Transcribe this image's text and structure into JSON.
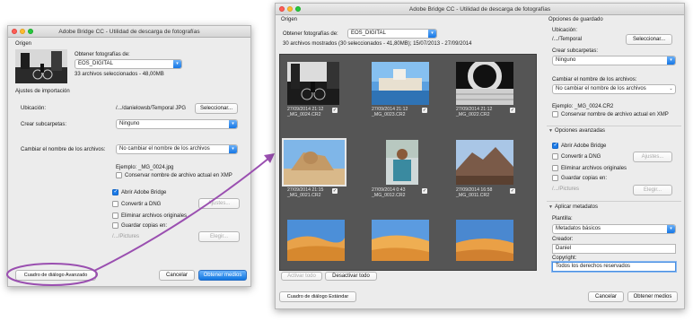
{
  "accent": "#1a7ae8",
  "annotation_color": "#9a4fb0",
  "left": {
    "title": "Adobe Bridge CC - Utilidad de descarga de fotografías",
    "origen": "Origen",
    "source_label": "Obtener fotografías de:",
    "source_value": "EOS_DIGITAL",
    "selected_info": "33 archivos seleccionados - 48,00MB",
    "import_settings": "Ajustes de importación",
    "location_label": "Ubicación:",
    "location_value": "/.../danielowsb/Temporal JPG",
    "choose_button": "Seleccionar...",
    "subfolders_label": "Crear subcarpetas:",
    "subfolders_value": "Ninguno",
    "rename_label": "Cambiar el nombre de los archivos:",
    "rename_value": "No cambiar el nombre de los archivos",
    "example": "Ejemplo: _MG_0024.jpg",
    "keep_name": "Conservar nombre de archivo actual en XMP",
    "open_bridge": "Abrir Adobe Bridge",
    "convert_dng": "Convertir a DNG",
    "settings_button": "Ajustes...",
    "delete_originals": "Eliminar archivos originales",
    "save_copies": "Guardar copias en:",
    "copies_path": "/.../Pictures",
    "choose2_button": "Elegir...",
    "advanced_button": "Cuadro de diálogo Avanzado",
    "cancel_button": "Cancelar",
    "get_media_button": "Obtener medios"
  },
  "right": {
    "title": "Adobe Bridge CC - Utilidad de descarga de fotografías",
    "origen": "Origen",
    "source_label": "Obtener fotografías de:",
    "source_value": "EOS_DIGITAL",
    "shown_info": "30 archivos mostrados (30 seleccionados - 41,80MB); 15/07/2013 - 27/09/2014",
    "thumbs": [
      {
        "date": "27/09/2014 21:12",
        "file": "_MG_0024.CR2"
      },
      {
        "date": "27/09/2014 21:12",
        "file": "_MG_0023.CR2"
      },
      {
        "date": "27/09/2014 21:12",
        "file": "_MG_0022.CR2"
      },
      {
        "date": "27/09/2014 21:15",
        "file": "_MG_0021.CR2"
      },
      {
        "date": "27/09/2014 0:43",
        "file": "_MG_0012.CR2"
      },
      {
        "date": "27/09/2014 16:58",
        "file": "_MG_0011.CR2"
      },
      {
        "date": "",
        "file": ""
      },
      {
        "date": "",
        "file": ""
      },
      {
        "date": "",
        "file": ""
      }
    ],
    "check_all": "Activar todo",
    "uncheck_all": "Desactivar todo",
    "save_options": "Opciones de guardado",
    "location_label": "Ubicación:",
    "location_value": "/.../Temporal",
    "choose_button": "Seleccionar...",
    "subfolders_label": "Crear subcarpetas:",
    "subfolders_value": "Ninguno",
    "rename_label": "Cambiar el nombre de los archivos:",
    "rename_value": "No cambiar el nombre de los archivos",
    "example": "Ejemplo: _MG_0024.CR2",
    "keep_name": "Conservar nombre de archivo actual en XMP",
    "advanced_options": "Opciones avanzadas",
    "open_bridge": "Abrir Adobe Bridge",
    "convert_dng": "Convertir a DNG",
    "settings_button": "Ajustes...",
    "delete_originals": "Eliminar archivos originales",
    "save_copies": "Guardar copias en:",
    "copies_path": "/.../Pictures",
    "choose2_button": "Elegir...",
    "apply_metadata": "Aplicar metadatos",
    "template_label": "Plantilla:",
    "template_value": "Metadatos básicos",
    "creator_label": "Creador:",
    "creator_value": "Daniel",
    "copyright_label": "Copyright:",
    "copyright_value": "Todos los derechos reservados",
    "standard_button": "Cuadro de diálogo Estándar",
    "cancel_button": "Cancelar",
    "get_media_button": "Obtener medios"
  }
}
